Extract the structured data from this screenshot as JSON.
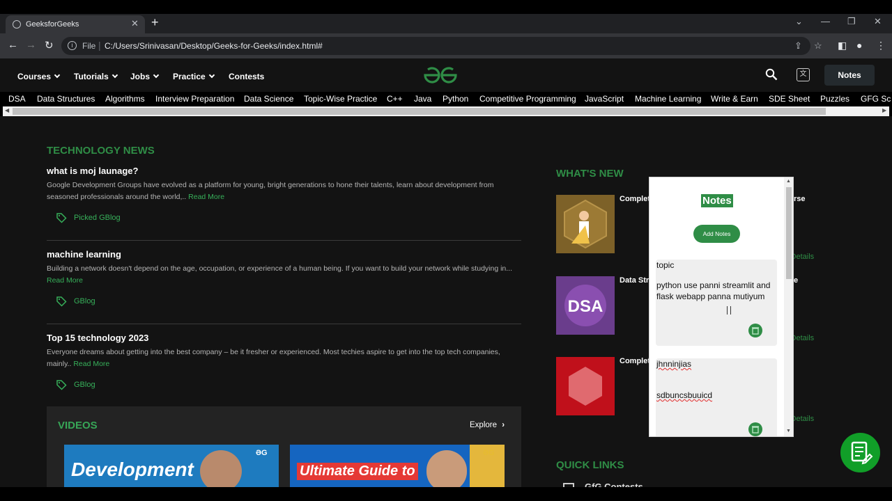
{
  "browser": {
    "tab_title": "GeeksforGeeks",
    "tab_close": "✕",
    "new_tab": "+",
    "scheme_label": "File",
    "url": "C:/Users/Srinivasan/Desktop/Geeks-for-Geeks/index.html#",
    "win_min": "—",
    "win_restore": "❐",
    "win_close": "✕",
    "tab_search": "⌄"
  },
  "header": {
    "menus": [
      "Courses",
      "Tutorials",
      "Jobs",
      "Practice",
      "Contests"
    ],
    "notes_button": "Notes",
    "logo_icon": "gfg-logo-icon"
  },
  "topics": [
    "DSA",
    "Data Structures",
    "Algorithms",
    "Interview Preparation",
    "Data Science",
    "Topic-Wise Practice",
    "C++",
    "Java",
    "Python",
    "Competitive Programming",
    "JavaScript",
    "Machine Learning",
    "Write & Earn",
    "SDE Sheet",
    "Puzzles",
    "GFG Sc"
  ],
  "tech_news": {
    "heading": "TECHNOLOGY NEWS",
    "read_more": "Read More",
    "items": [
      {
        "title": "what is moj launage?",
        "desc_line1": "Google Development Groups have evolved as a platform for young, bright generations to hone their talents, learn about development from",
        "desc_line2": "seasoned professionals around the world,..",
        "tag": "Picked GBlog"
      },
      {
        "title": "machine learning",
        "desc_line1": "Building a network doesn't depend on the age, occupation, or experience of a human being. If you want to build your network while studying in...",
        "desc_line2": "",
        "tag": "GBlog"
      },
      {
        "title": "Top 15 technology 2023",
        "desc_line1": "Everyone dreams about getting into the best company – be it fresher or experienced. Most techies aspire to get into the top tech companies,",
        "desc_line2": "mainly..",
        "tag": "GBlog"
      }
    ]
  },
  "videos": {
    "heading": "VIDEOS",
    "explore": "Explore",
    "thumbs": [
      {
        "title": "Development",
        "bg": "#1e7bbf"
      },
      {
        "title": "Ultimate Guide to",
        "bg": "#1565c0"
      }
    ]
  },
  "whats_new": {
    "heading": "WHAT'S NEW",
    "items": [
      {
        "title": "Complet",
        "suffix": "rse",
        "view": "v Details",
        "icon": "course-person-icon"
      },
      {
        "title": "Data Str",
        "suffix": "e",
        "view": "v Details",
        "icon": "dsa-hexagon-icon"
      },
      {
        "title": "Complet",
        "suffix": "",
        "view": "v Details",
        "icon": "red-hexagon-icon"
      }
    ]
  },
  "quick_links": {
    "heading": "QUICK LINKS",
    "first": "GfG Contests"
  },
  "notes_panel": {
    "title": "Notes",
    "add_button": "Add Notes",
    "notes": [
      {
        "title": "topic",
        "body": "python use panni streamlit and flask webapp panna mutiyum"
      },
      {
        "title": "jhnninjias",
        "body": "sdbuncsbuuicd"
      }
    ]
  },
  "colors": {
    "brand_green": "#2f8d46",
    "link_green": "#37b05a",
    "fab_green": "#119e28"
  }
}
